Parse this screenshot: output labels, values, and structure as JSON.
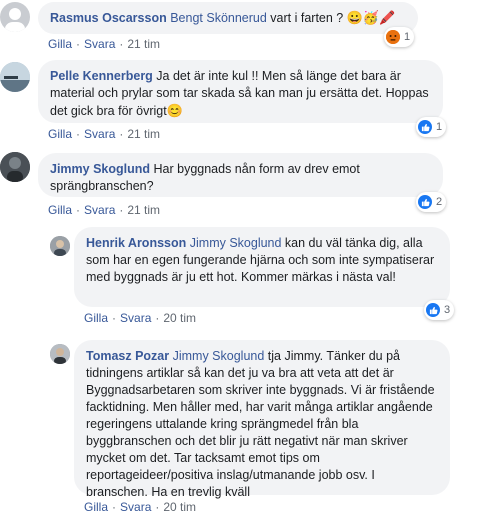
{
  "comments": [
    {
      "author": "Rasmus Oscarsson",
      "mention": "Bengt Skönnerud",
      "text": " vart i farten ? ",
      "emojis": "😀🥳🖍️",
      "like": "Gilla",
      "reply": "Svara",
      "time": "21 tim",
      "reaction_count": "1",
      "reaction_type": "angry",
      "avatar_icon": "avatar-placeholder-icon"
    },
    {
      "author": "Pelle Kennerberg",
      "text": " Ja det är inte kul !! Men så länge det bara är material och prylar som tar skada så kan man ju ersätta det. Hoppas det gick bra för övrigt",
      "emojis": "😊",
      "like": "Gilla",
      "reply": "Svara",
      "time": "21 tim",
      "reaction_count": "1",
      "reaction_type": "like",
      "avatar_icon": "landscape-avatar-icon"
    },
    {
      "author": "Jimmy Skoglund",
      "text": " Har byggnads nån form av drev emot sprängbranschen?",
      "like": "Gilla",
      "reply": "Svara",
      "time": "21 tim",
      "reaction_count": "2",
      "reaction_type": "like",
      "avatar_icon": "dark-avatar-icon"
    }
  ],
  "replies": [
    {
      "author": "Henrik Aronsson",
      "mention": "Jimmy Skoglund",
      "text": " kan du väl tänka dig, alla som har en egen fungerande hjärna och som inte sympatiserar med byggnads är ju ett hot. Kommer märkas i nästa val!",
      "like": "Gilla",
      "reply": "Svara",
      "time": "20 tim",
      "reaction_count": "3",
      "reaction_type": "like",
      "avatar_icon": "person-avatar-icon"
    },
    {
      "author": "Tomasz Pozar",
      "mention": "Jimmy Skoglund",
      "text": " tja Jimmy. Tänker du på tidningens artiklar så kan det ju va bra att veta att det är Byggnadsarbetaren som skriver inte byggnads. Vi är fristående facktidning. Men håller med, har varit många artiklar angående regeringens uttalande kring sprängmedel från bla byggbranschen och det blir ju rätt negativt när man skriver mycket om det. Tar tacksamt emot tips om reportageideer/positiva inslag/utmanande jobb osv. I branschen. Ha en trevlig kväll",
      "like": "Gilla",
      "reply": "Svara",
      "time": "20 tim",
      "avatar_icon": "person-avatar-icon"
    }
  ],
  "colors": {
    "link": "#385898",
    "bubble": "#f2f3f5",
    "like": "#1877f2",
    "meta": "#606770"
  }
}
